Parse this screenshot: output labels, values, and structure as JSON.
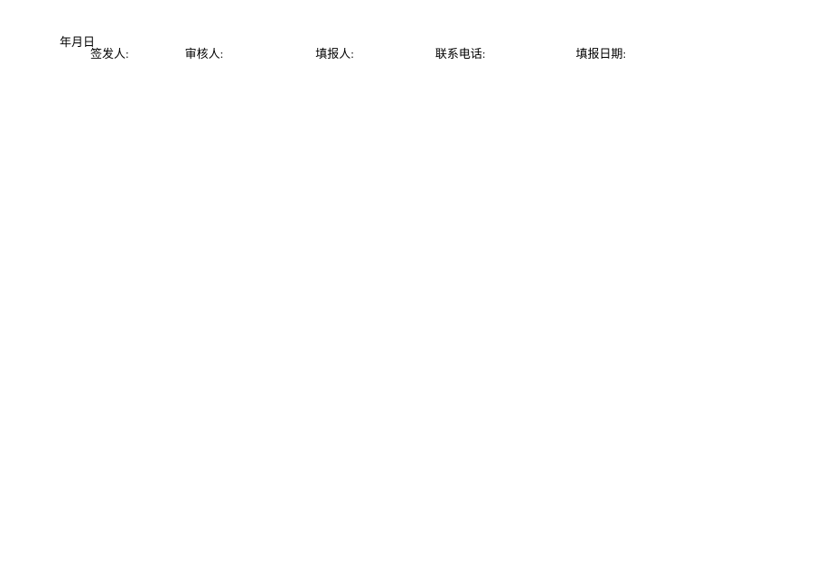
{
  "date_line": "年月日",
  "fields": {
    "issuer": "签发人:",
    "reviewer": "审核人:",
    "reporter": "填报人:",
    "phone": "联系电话:",
    "report_date": "填报日期:"
  }
}
